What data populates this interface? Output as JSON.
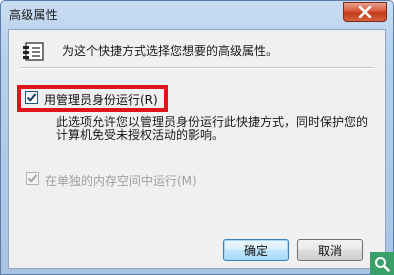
{
  "window": {
    "title": "高级属性",
    "close_icon": "close-icon"
  },
  "intro": {
    "icon": "properties-icon",
    "text": "为这个快捷方式选择您想要的高级属性。"
  },
  "run_as_admin": {
    "checked": true,
    "label": "用管理员身份运行(R)",
    "highlight_color": "#e0141c"
  },
  "description": {
    "text": "此选项允许您以管理员身份运行此快捷方式，同时保护您的计算机免受未授权活动的影响。"
  },
  "separate_memory": {
    "checked": true,
    "disabled": true,
    "label": "在单独的内存空间中运行(M)"
  },
  "buttons": {
    "ok": "确定",
    "cancel": "取消"
  },
  "corner_badge": {
    "icon": "magnifier-icon",
    "color": "#3aa06a"
  }
}
